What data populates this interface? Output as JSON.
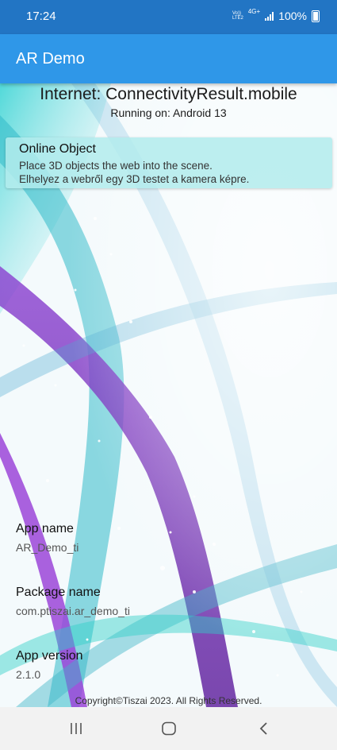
{
  "status_bar": {
    "time": "17:24",
    "network_top": "Vo))",
    "network_bottom": "LTE2",
    "network_type": "4G+",
    "battery": "100%",
    "icons": [
      "signal-icon",
      "battery-icon"
    ]
  },
  "app_bar": {
    "title": "AR Demo"
  },
  "connectivity": {
    "internet": "Internet: ConnectivityResult.mobile",
    "running_on": "Running on: Android 13"
  },
  "card": {
    "title": "Online Object",
    "line1": "Place 3D objects the web into the scene.",
    "line2": "Elhelyez a webről egy 3D testet a kamera képre."
  },
  "app_info": {
    "app_name_label": "App name",
    "app_name_value": "AR_Demo_ti",
    "package_label": "Package name",
    "package_value": "com.ptiszai.ar_demo_ti",
    "version_label": "App version",
    "version_value": "2.1.0"
  },
  "footer": {
    "copyright": "Copyright©Tiszai 2023. All Rights Reserved."
  },
  "nav": {
    "icons": [
      "recent-apps-icon",
      "home-icon",
      "back-icon"
    ]
  },
  "colors": {
    "status_bar": "#2275c4",
    "app_bar": "#2f97e8",
    "card": "#b2ebec"
  }
}
